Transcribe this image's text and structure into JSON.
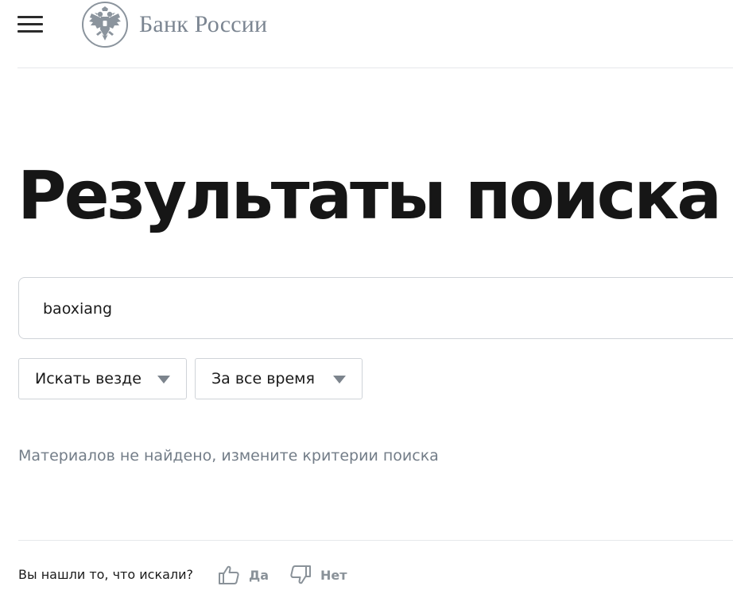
{
  "header": {
    "menu_icon": "hamburger-menu-icon",
    "logo_icon": "double-headed-eagle-emblem",
    "logo_text": "Банк России"
  },
  "main": {
    "title": "Результаты поиска",
    "search": {
      "value": "baoxiang",
      "placeholder": ""
    },
    "filters": {
      "scope": {
        "selected": "Искать везде"
      },
      "period": {
        "selected": "За все время"
      }
    },
    "empty_message": "Материалов не найдено, измените критерии поиска"
  },
  "feedback": {
    "question": "Вы нашли то, что искали?",
    "yes_label": "Да",
    "no_label": "Нет",
    "yes_icon": "thumbs-up-icon",
    "no_icon": "thumbs-down-icon"
  },
  "colors": {
    "logo_gray": "#7b8591",
    "muted_text": "#737d88",
    "border": "#cfd3d8",
    "divider": "#e6e8eb"
  }
}
